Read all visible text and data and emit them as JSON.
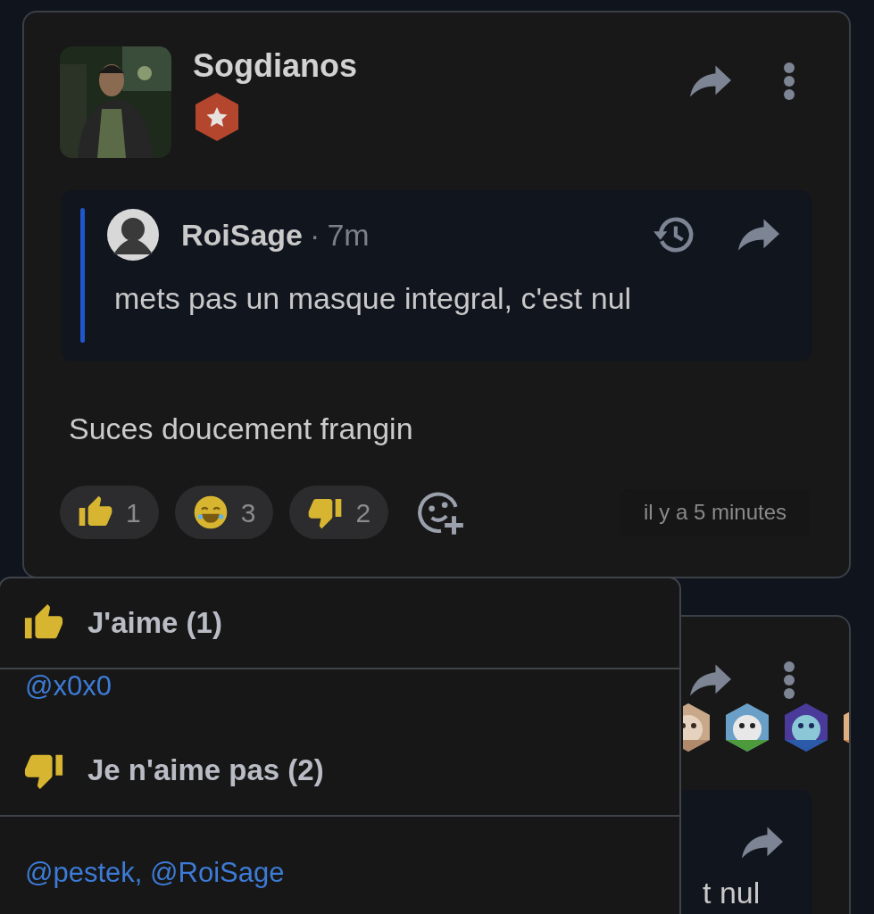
{
  "post": {
    "author": "Sogdianos",
    "quote": {
      "author": "RoiSage",
      "separator": "·",
      "time": "7m",
      "text": "mets pas un masque integral, c'est nul"
    },
    "text": "Suces doucement frangin",
    "reactions": [
      {
        "kind": "thumbs-up",
        "count": "1"
      },
      {
        "kind": "laugh",
        "count": "3"
      },
      {
        "kind": "thumbs-down",
        "count": "2"
      }
    ],
    "timestamp": "il y a 5 minutes"
  },
  "reactions_popup": {
    "groups": [
      {
        "kind": "thumbs-up",
        "title": "J'aime (1)",
        "users": "@x0x0"
      },
      {
        "kind": "thumbs-down",
        "title": "Je n'aime pas (2)",
        "users": "@pestek, @RoiSage"
      }
    ]
  },
  "next_post": {
    "quote": {
      "text": "t nul"
    }
  }
}
